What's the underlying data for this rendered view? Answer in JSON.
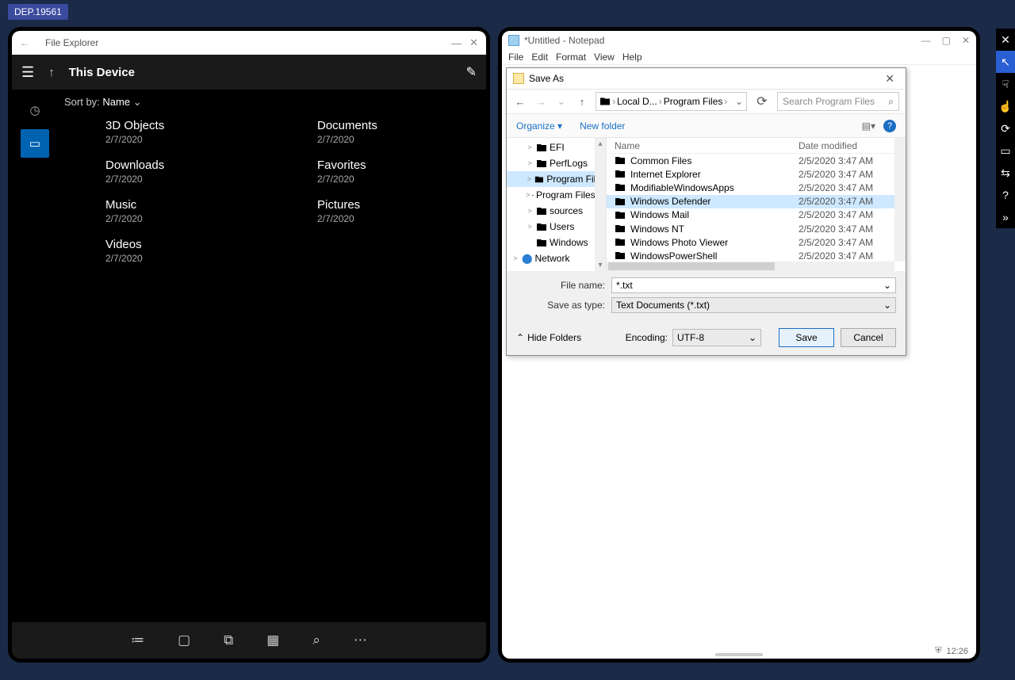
{
  "tag": "DEP.19561",
  "file_explorer": {
    "titlebar": {
      "title": "File Explorer"
    },
    "header": {
      "location": "This Device"
    },
    "sort": {
      "prefix": "Sort by:",
      "value": "Name"
    },
    "folders": [
      {
        "name": "3D Objects",
        "date": "2/7/2020"
      },
      {
        "name": "Documents",
        "date": "2/7/2020"
      },
      {
        "name": "Downloads",
        "date": "2/7/2020"
      },
      {
        "name": "Favorites",
        "date": "2/7/2020"
      },
      {
        "name": "Music",
        "date": "2/7/2020"
      },
      {
        "name": "Pictures",
        "date": "2/7/2020"
      },
      {
        "name": "Videos",
        "date": "2/7/2020"
      }
    ]
  },
  "notepad": {
    "title": "*Untitled - Notepad",
    "menu": [
      "File",
      "Edit",
      "Format",
      "View",
      "Help"
    ],
    "clock": "12:26"
  },
  "save_as": {
    "title": "Save As",
    "breadcrumb": [
      "Local D...",
      "Program Files"
    ],
    "search_placeholder": "Search Program Files",
    "toolbar": {
      "organize": "Organize",
      "newfolder": "New folder"
    },
    "tree": [
      {
        "label": "EFI",
        "depth": 1,
        "exp": ">"
      },
      {
        "label": "PerfLogs",
        "depth": 1,
        "exp": ">"
      },
      {
        "label": "Program Files",
        "depth": 1,
        "exp": ">",
        "selected": true
      },
      {
        "label": "Program Files (x",
        "depth": 1,
        "exp": ">"
      },
      {
        "label": "sources",
        "depth": 1,
        "exp": ">"
      },
      {
        "label": "Users",
        "depth": 1,
        "exp": ">"
      },
      {
        "label": "Windows",
        "depth": 1,
        "exp": ""
      },
      {
        "label": "Network",
        "depth": 0,
        "exp": ">",
        "net": true
      }
    ],
    "columns": {
      "name": "Name",
      "date": "Date modified"
    },
    "files": [
      {
        "name": "Common Files",
        "date": "2/5/2020 3:47 AM"
      },
      {
        "name": "Internet Explorer",
        "date": "2/5/2020 3:47 AM"
      },
      {
        "name": "ModifiableWindowsApps",
        "date": "2/5/2020 3:47 AM"
      },
      {
        "name": "Windows Defender",
        "date": "2/5/2020 3:47 AM",
        "selected": true
      },
      {
        "name": "Windows Mail",
        "date": "2/5/2020 3:47 AM"
      },
      {
        "name": "Windows NT",
        "date": "2/5/2020 3:47 AM"
      },
      {
        "name": "Windows Photo Viewer",
        "date": "2/5/2020 3:47 AM"
      },
      {
        "name": "WindowsPowerShell",
        "date": "2/5/2020 3:47 AM"
      }
    ],
    "filename": {
      "label": "File name:",
      "value": "*.txt"
    },
    "filetype": {
      "label": "Save as type:",
      "value": "Text Documents (*.txt)"
    },
    "hide_folders": "Hide Folders",
    "encoding": {
      "label": "Encoding:",
      "value": "UTF-8"
    },
    "save": "Save",
    "cancel": "Cancel"
  }
}
